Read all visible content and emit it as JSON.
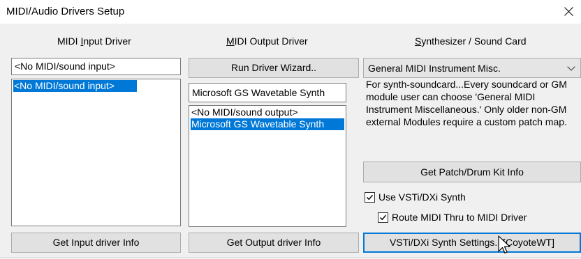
{
  "window": {
    "title": "MIDI/Audio Drivers Setup"
  },
  "input_col": {
    "header_pre": "MIDI ",
    "header_u": "I",
    "header_post": "nput Driver",
    "selected_value": "<No MIDI/sound input>",
    "items": [
      "<No MIDI/sound input>"
    ],
    "info_button": "Get Input driver Info"
  },
  "output_col": {
    "header_pre": "",
    "header_u": "M",
    "header_post": "IDI Output Driver",
    "wizard_button": "Run Driver Wizard..",
    "selected_value": "Microsoft GS Wavetable Synth",
    "items": [
      "<No MIDI/sound output>",
      "Microsoft GS Wavetable Synth"
    ],
    "selected_index": 1,
    "info_button": "Get Output driver Info"
  },
  "synth_col": {
    "header_u": "S",
    "header_post": "ynthesizer / Sound Card",
    "combo_value": "General MIDI Instrument Misc.",
    "description_lines": [
      "For synth-soundcard...Every soundcard or GM",
      "module user can choose 'General MIDI",
      "Instrument Miscellaneous.' Only older non-GM",
      "external Modules require a custom patch map."
    ],
    "patch_button": "Get Patch/Drum Kit Info",
    "use_vsti_label": "Use VSTi/DXi Synth",
    "use_vsti_checked": true,
    "route_label": "Route MIDI Thru to MIDI Driver",
    "route_checked": true,
    "vsti_settings_button": "VSTi/DXi Synth Settings.. [CoyoteWT]"
  },
  "colors": {
    "selection": "#0078d7",
    "focus_border": "#0078d7"
  }
}
